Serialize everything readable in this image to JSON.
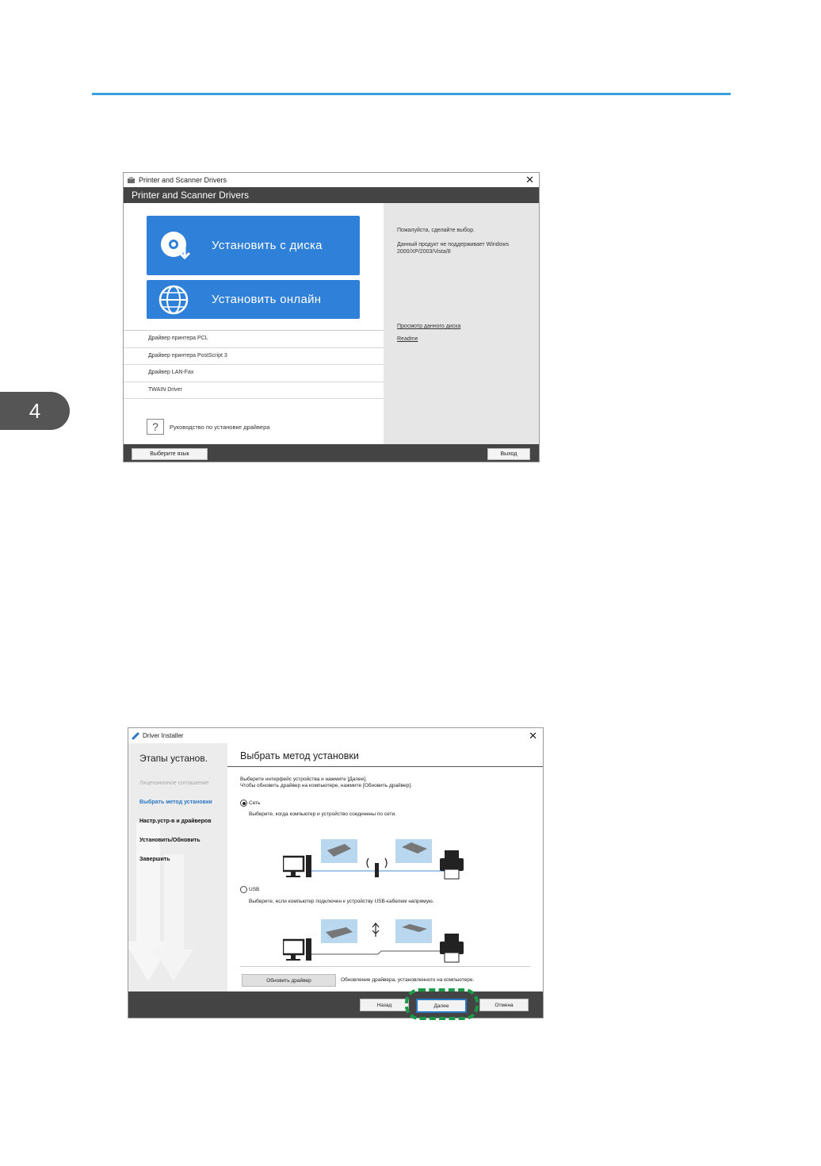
{
  "chapter_tab": "4",
  "window1": {
    "title": "Printer and Scanner Drivers",
    "banner": "Printer and Scanner Drivers",
    "install_disc_label": "Установить с диска",
    "install_online_label": "Установить онлайн",
    "drivers": [
      "Драйвер принтера PCL",
      "Драйвер принтера PostScript 3",
      "Драйвер LAN-Fax",
      "TWAIN Driver"
    ],
    "help_label": "Руководство по установке драйвера",
    "info_prompt": "Пожалуйста, сделайте выбор.",
    "info_notice": "Данный продукт не поддерживает Windows 2000/XP/2003/Vista/8",
    "link_browse": "Просмотр данного диска",
    "link_readme": "Readme",
    "language_button": "Выберите язык",
    "exit_button": "Выход"
  },
  "window2": {
    "title": "Driver Installer",
    "side_title": "Этапы установ.",
    "steps": [
      "Лицензионное соглашение",
      "Выбрать метод установки",
      "Настр.устр-в и драйверов",
      "Установить/Обновить",
      "Завершить"
    ],
    "heading": "Выбрать метод установки",
    "instruction_1": "Выберите интерфейс устройства и нажмите [Далее].",
    "instruction_2": "Чтобы обновить драйвер на компьютере, нажмите [Обновить драйвер].",
    "option_network": "Сеть",
    "network_desc": "Выберите, когда компьютер и устройство соединены по сети.",
    "option_usb": "USB",
    "usb_desc": "Выберите, если компьютер подключен к устройству USB-кабелем напрямую.",
    "update_button": "Обновить драйвер",
    "update_desc": "Обновление драйвера, установленного на компьютере.",
    "back_button": "Назад",
    "next_button": "Далее",
    "cancel_button": "Отмена"
  },
  "colors": {
    "accent_blue": "#2f80d8",
    "header_rule": "#3a9fdc",
    "highlight_green": "#1a9a47"
  }
}
